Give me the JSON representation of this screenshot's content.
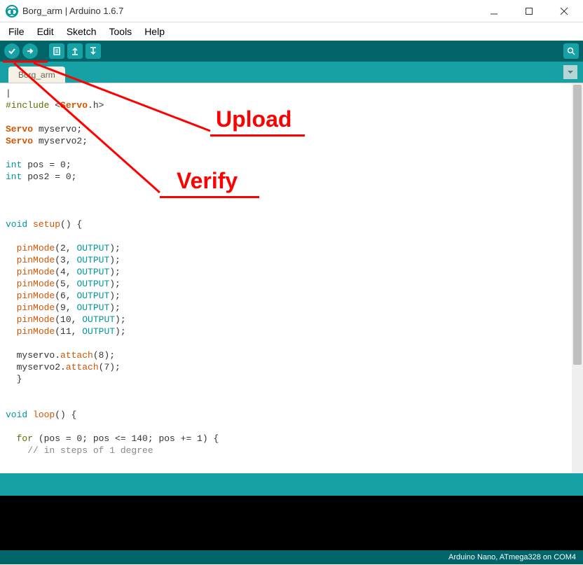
{
  "window": {
    "title": "Borg_arm | Arduino 1.6.7"
  },
  "menu": {
    "file": "File",
    "edit": "Edit",
    "sketch": "Sketch",
    "tools": "Tools",
    "help": "Help"
  },
  "tab": {
    "name": "Borg_arm"
  },
  "annotations": {
    "upload": "Upload",
    "verify": "Verify"
  },
  "footer": {
    "status": "Arduino Nano, ATmega328 on COM4"
  },
  "code": {
    "include_pre": "#include ",
    "include_lt": "<",
    "include_lib": "Servo",
    "include_h": ".h>",
    "servo_type": "Servo",
    "servo1": " myservo;",
    "servo2": " myservo2;",
    "int_kw": "int",
    "pos_decl": " pos = 0;",
    "pos2_decl": " pos2 = 0;",
    "void_kw": "void",
    "setup_fn": "setup",
    "paren_brace": "() {",
    "pinmode": "pinMode",
    "pm2": "(2, ",
    "pm3": "(3, ",
    "pm4": "(4, ",
    "pm5": "(5, ",
    "pm6": "(6, ",
    "pm9": "(9, ",
    "pm10": "(10, ",
    "pm11": "(11, ",
    "output": "OUTPUT",
    "close_pm": ");",
    "attach1_a": "  myservo.",
    "attach1_b": "attach",
    "attach1_c": "(8);",
    "attach2_a": "  myservo2.",
    "attach2_c": "(7);",
    "brace_close": "  }",
    "loop_fn": "loop",
    "for_kw": "for",
    "for_body": " (pos = 0; pos <= 140; pos += 1) {",
    "comment": "    // in steps of 1 degree"
  }
}
